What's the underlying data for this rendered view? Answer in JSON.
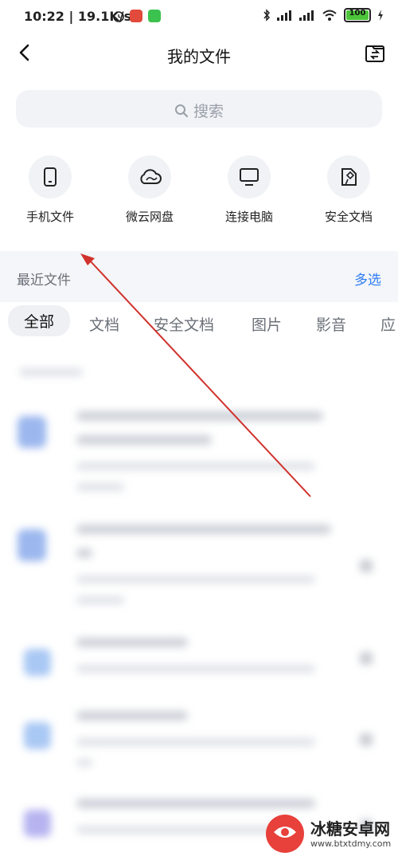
{
  "status_bar": {
    "time_speed": "10:22 | 19.1K/s",
    "battery": "100"
  },
  "header": {
    "title": "我的文件"
  },
  "search": {
    "placeholder": "搜索"
  },
  "quick_actions": [
    {
      "label": "手机文件",
      "icon": "phone-icon"
    },
    {
      "label": "微云网盘",
      "icon": "cloud-icon"
    },
    {
      "label": "连接电脑",
      "icon": "monitor-icon"
    },
    {
      "label": "安全文档",
      "icon": "secure-doc-icon"
    }
  ],
  "recent": {
    "title": "最近文件",
    "multi_select": "多选"
  },
  "tabs": [
    "全部",
    "文档",
    "安全文档",
    "图片",
    "影音",
    "应"
  ],
  "watermark": {
    "main": "冰糖安卓网",
    "sub": "www.btxtdmy.com"
  },
  "colors": {
    "accent": "#2f7df6",
    "arrow": "#d0322d",
    "battery": "#4cc53a"
  }
}
